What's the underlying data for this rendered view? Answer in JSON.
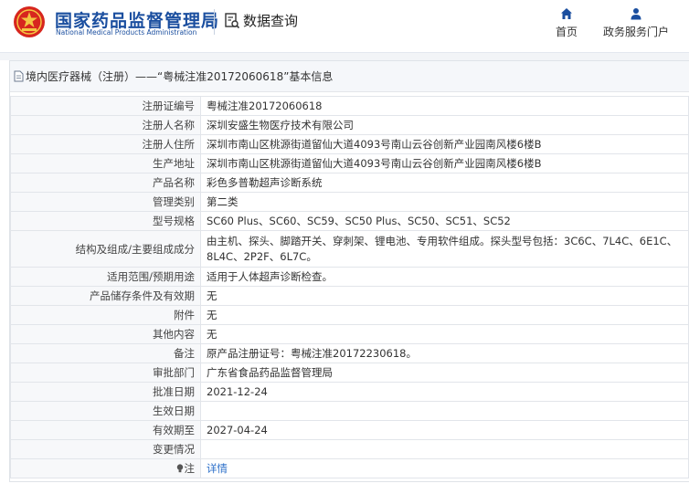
{
  "header": {
    "site_name": "国家药品监督管理局",
    "site_sub": "National Medical Products Administration",
    "query_label": "数据查询",
    "nav": {
      "home": "首页",
      "portal": "政务服务门户"
    }
  },
  "panel": {
    "title": "境内医疗器械（注册）——“粤械注准20172060618”基本信息"
  },
  "rows": [
    {
      "key": "注册证编号",
      "value": "粤械注准20172060618"
    },
    {
      "key": "注册人名称",
      "value": "深圳安盛生物医疗技术有限公司"
    },
    {
      "key": "注册人住所",
      "value": "深圳市南山区桃源街道留仙大道4093号南山云谷创新产业园南风楼6楼B"
    },
    {
      "key": "生产地址",
      "value": "深圳市南山区桃源街道留仙大道4093号南山云谷创新产业园南风楼6楼B"
    },
    {
      "key": "产品名称",
      "value": "彩色多普勒超声诊断系统"
    },
    {
      "key": "管理类别",
      "value": "第二类"
    },
    {
      "key": "型号规格",
      "value": "SC60 Plus、SC60、SC59、SC50 Plus、SC50、SC51、SC52"
    },
    {
      "key": "结构及组成/主要组成成分",
      "value": "由主机、探头、脚踏开关、穿刺架、锂电池、专用软件组成。探头型号包括：3C6C、7L4C、6E1C、8L4C、2P2F、6L7C。"
    },
    {
      "key": "适用范围/预期用途",
      "value": "适用于人体超声诊断检查。"
    },
    {
      "key": "产品储存条件及有效期",
      "value": "无"
    },
    {
      "key": "附件",
      "value": "无"
    },
    {
      "key": "其他内容",
      "value": "无"
    },
    {
      "key": "备注",
      "value": "原产品注册证号：粤械注准20172230618。"
    },
    {
      "key": "审批部门",
      "value": "广东省食品药品监督管理局"
    },
    {
      "key": "批准日期",
      "value": "2021-12-24"
    },
    {
      "key": "生效日期",
      "value": ""
    },
    {
      "key": "有效期至",
      "value": "2027-04-24"
    },
    {
      "key": "变更情况",
      "value": ""
    },
    {
      "key": "注",
      "value": "详情"
    }
  ],
  "colors": {
    "brand": "#1a4e9f",
    "link": "#2c6fc9",
    "logo_red": "#d7261e"
  },
  "icons": [
    "emblem-logo",
    "database-search-icon",
    "home-icon",
    "user-icon",
    "document-icon",
    "lightbulb-icon"
  ]
}
